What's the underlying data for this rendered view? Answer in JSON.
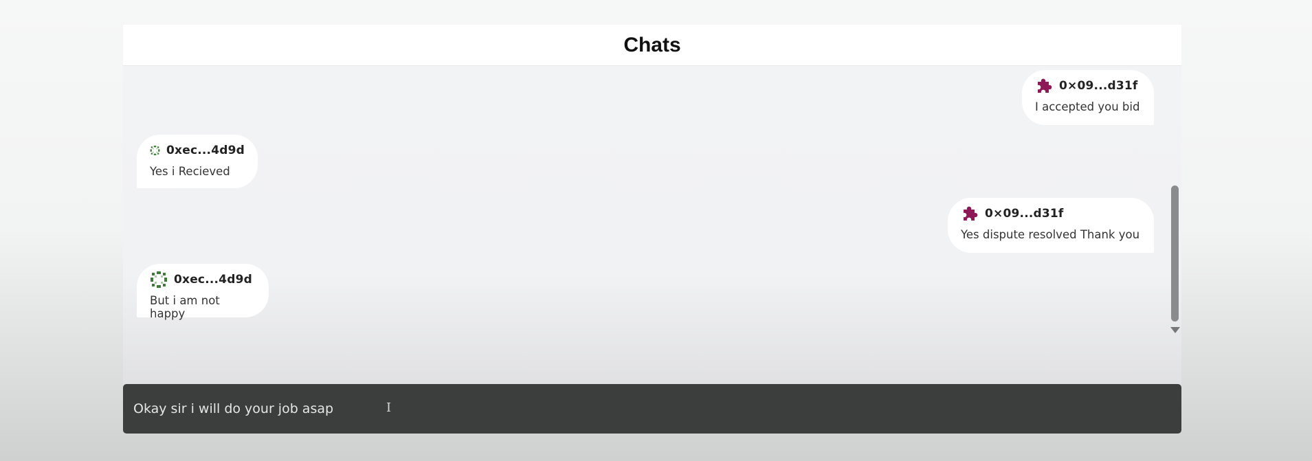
{
  "header": {
    "title": "Chats"
  },
  "messages": [
    {
      "side": "right",
      "avatar": "puzzle-icon",
      "sender": "0×09...d31f",
      "text": "I accepted you bid"
    },
    {
      "side": "left",
      "avatar": "dotted-ring-icon",
      "sender": "0xec...4d9d",
      "text": "Yes i Recieved"
    },
    {
      "side": "right",
      "avatar": "puzzle-icon",
      "sender": "0×09...d31f",
      "text": "Yes dispute resolved Thank you"
    },
    {
      "side": "left",
      "avatar": "dotted-ring-icon",
      "sender": "0xec...4d9d",
      "text": "But i am not happy"
    }
  ],
  "composer": {
    "value": "Okay sir i will do your job asap"
  },
  "colors": {
    "puzzle_avatar": "#8d1a57",
    "ring_avatar": "#3f7a3a",
    "composer_bg": "#3c3d3d"
  }
}
